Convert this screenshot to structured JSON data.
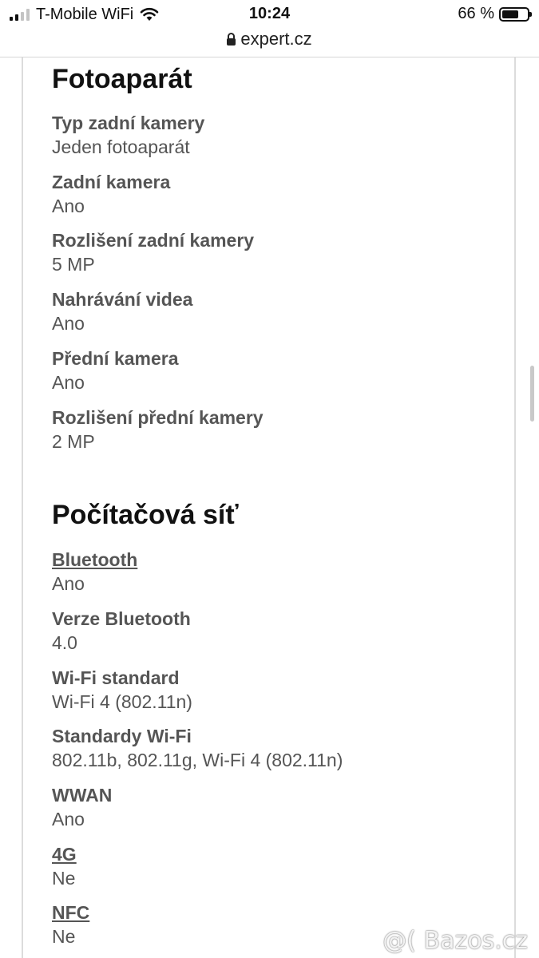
{
  "status_bar": {
    "carrier": "T-Mobile WiFi",
    "time": "10:24",
    "battery_percent": "66 %",
    "battery_level": 0.66
  },
  "browser": {
    "url": "expert.cz"
  },
  "sections": [
    {
      "title": "Fotoaparát",
      "specs": [
        {
          "label": "Typ zadní kamery",
          "value": "Jeden fotoaparát"
        },
        {
          "label": "Zadní kamera",
          "value": "Ano"
        },
        {
          "label": "Rozlišení zadní kamery",
          "value": "5 MP"
        },
        {
          "label": "Nahrávání videa",
          "value": "Ano"
        },
        {
          "label": "Přední kamera",
          "value": "Ano"
        },
        {
          "label": "Rozlišení přední kamery",
          "value": "2 MP"
        }
      ]
    },
    {
      "title": "Počítačová síť",
      "specs": [
        {
          "label": "Bluetooth",
          "value": "Ano",
          "link": true
        },
        {
          "label": "Verze Bluetooth",
          "value": "4.0"
        },
        {
          "label": "Wi-Fi standard",
          "value": "Wi-Fi 4 (802.11n)"
        },
        {
          "label": "Standardy Wi-Fi",
          "value": "802.11b, 802.11g, Wi-Fi 4 (802.11n)"
        },
        {
          "label": "WWAN",
          "value": "Ano"
        },
        {
          "label": "4G",
          "value": "Ne",
          "link": true
        },
        {
          "label": "NFC",
          "value": "Ne",
          "link": true
        }
      ]
    }
  ],
  "watermark": "@( Bazos.cz"
}
